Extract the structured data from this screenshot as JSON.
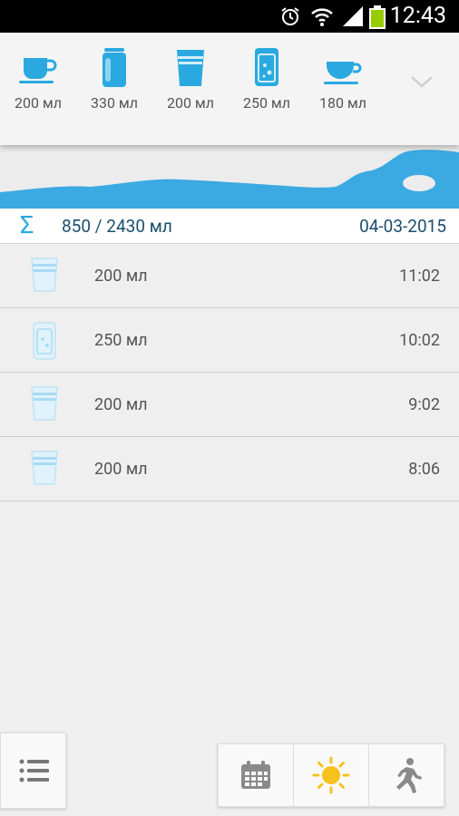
{
  "status": {
    "time": "12:43"
  },
  "drinks": [
    {
      "icon": "cup-icon",
      "label": "200 мл"
    },
    {
      "icon": "can-icon",
      "label": "330 мл"
    },
    {
      "icon": "glass-icon",
      "label": "200 мл"
    },
    {
      "icon": "soda-glass-icon",
      "label": "250 мл"
    },
    {
      "icon": "teacup-icon",
      "label": "180 мл"
    }
  ],
  "summary": {
    "total": "850 / 2430 мл",
    "date": "04-03-2015"
  },
  "entries": [
    {
      "icon": "glass-icon",
      "volume": "200 мл",
      "time": "11:02"
    },
    {
      "icon": "soda-glass-icon",
      "volume": "250 мл",
      "time": "10:02"
    },
    {
      "icon": "glass-icon",
      "volume": "200 мл",
      "time": "9:02"
    },
    {
      "icon": "glass-icon",
      "volume": "200 мл",
      "time": "8:06"
    }
  ],
  "progress": {
    "consumed_ml": 850,
    "goal_ml": 2430
  },
  "colors": {
    "accent": "#29a9e0",
    "water": "#3ba9e2",
    "text_dark": "#1b4f6e",
    "sun": "#f7c21d"
  }
}
